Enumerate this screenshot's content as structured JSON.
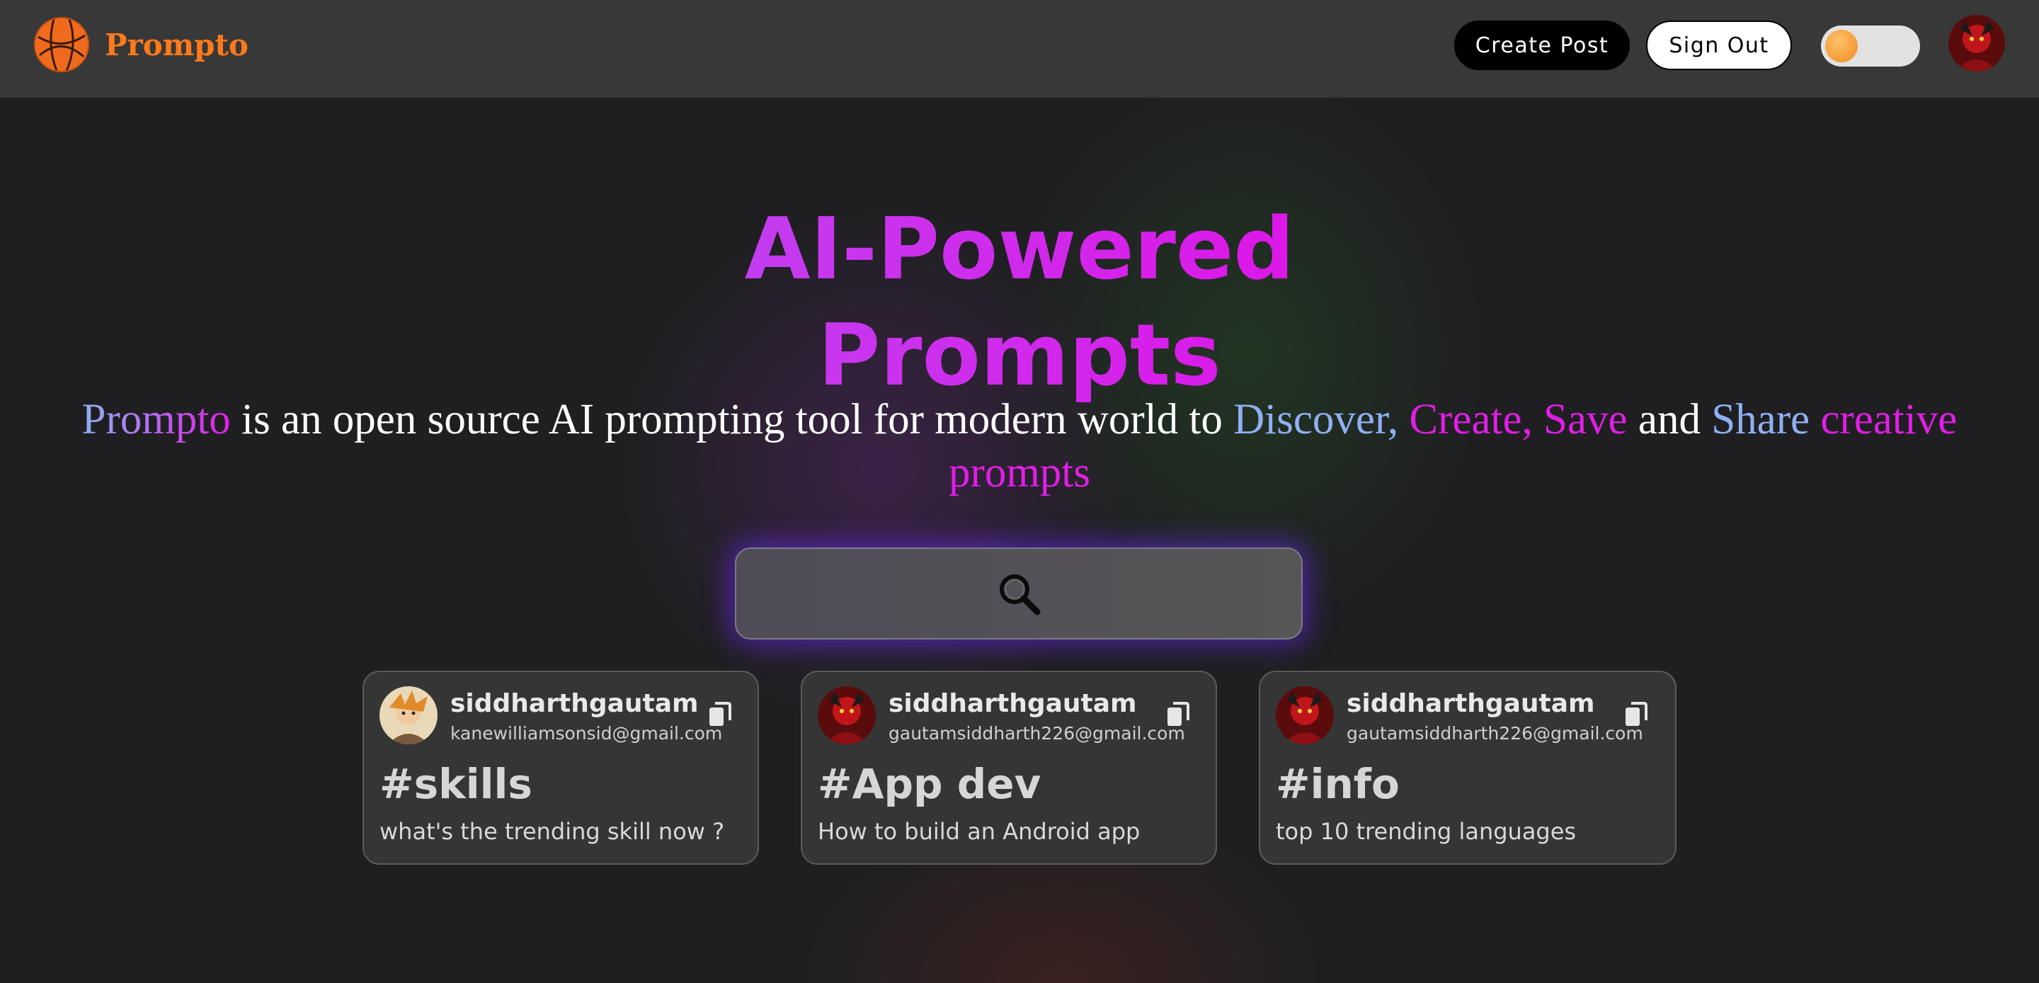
{
  "app": {
    "name": "Prompto",
    "brand_color": "#ff7a1a"
  },
  "navbar": {
    "create_post_label": "Create Post",
    "sign_out_label": "Sign Out",
    "theme_toggle_state": "off",
    "avatar_icon": "user-avatar"
  },
  "hero": {
    "title_line1": "AI-Powered",
    "title_line2": "Prompts",
    "gradient_colors": [
      "#7fb7f4",
      "#c23ff0",
      "#e30de6"
    ],
    "description": {
      "brand": "Prompto",
      "text1": " is an open source AI prompting tool for modern world to ",
      "discover": "Discover,",
      "create": " Create,",
      "save": " Save",
      "and": " and ",
      "share": "Share",
      "creative_prompts": " creative prompts"
    }
  },
  "search": {
    "placeholder": "",
    "icon": "search-icon"
  },
  "cards": [
    {
      "username": "siddharthgautam",
      "email": "kanewilliamsonsid@gmail.com",
      "tag": "#skills",
      "prompt": "what's the trending skill now ?",
      "copy_icon": "copy-icon"
    },
    {
      "username": "siddharthgautam",
      "email": "gautamsiddharth226@gmail.com",
      "tag": "#App dev",
      "prompt": "How to build an Android app",
      "copy_icon": "copy-icon"
    },
    {
      "username": "siddharthgautam",
      "email": "gautamsiddharth226@gmail.com",
      "tag": "#info",
      "prompt": "top 10 trending languages",
      "copy_icon": "copy-icon"
    }
  ]
}
